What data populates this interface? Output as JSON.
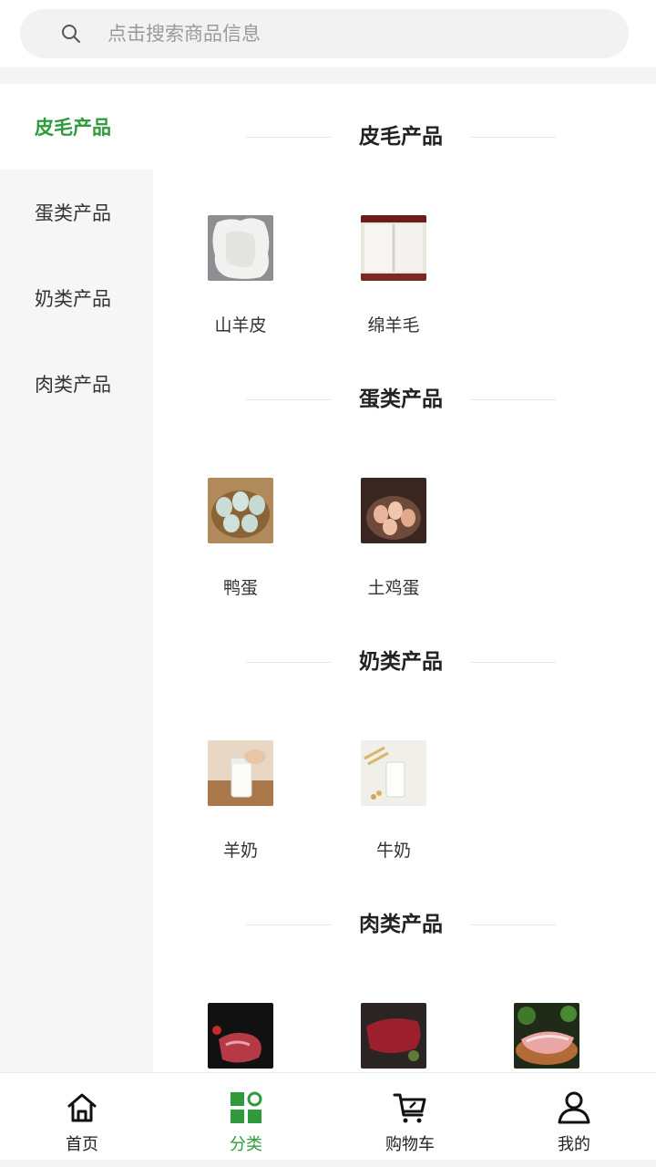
{
  "search": {
    "placeholder": "点击搜索商品信息",
    "value": ""
  },
  "sidebar": {
    "items": [
      {
        "label": "皮毛产品",
        "active": true
      },
      {
        "label": "蛋类产品"
      },
      {
        "label": "奶类产品"
      },
      {
        "label": "肉类产品"
      }
    ]
  },
  "sections": [
    {
      "title": "皮毛产品",
      "products": [
        {
          "name": "山羊皮"
        },
        {
          "name": "绵羊毛"
        }
      ]
    },
    {
      "title": "蛋类产品",
      "products": [
        {
          "name": "鸭蛋"
        },
        {
          "name": "土鸡蛋"
        }
      ]
    },
    {
      "title": "奶类产品",
      "products": [
        {
          "name": "羊奶"
        },
        {
          "name": "牛奶"
        }
      ]
    },
    {
      "title": "肉类产品",
      "products": []
    }
  ],
  "tabbar": {
    "items": [
      {
        "label": "首页",
        "icon": "home-icon"
      },
      {
        "label": "分类",
        "icon": "category-icon",
        "active": true
      },
      {
        "label": "购物车",
        "icon": "cart-icon"
      },
      {
        "label": "我的",
        "icon": "user-icon"
      }
    ]
  },
  "colors": {
    "accent": "#2e9a3c",
    "text": "#222222",
    "muted": "#9a9a9a",
    "sidebar_bg": "#f6f6f6"
  }
}
